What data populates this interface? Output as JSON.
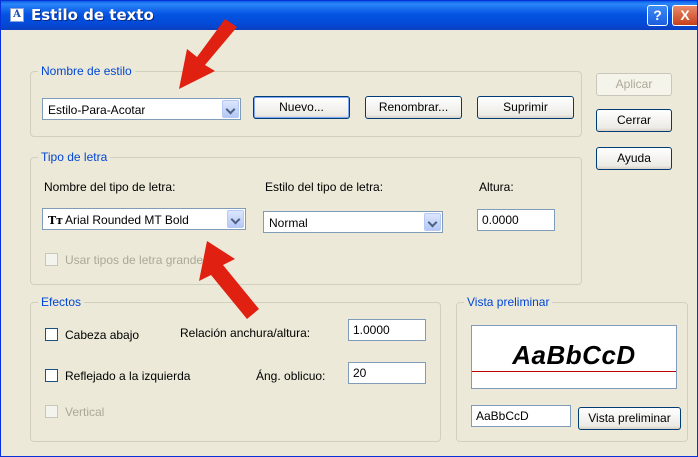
{
  "window": {
    "title": "Estilo de texto",
    "help_button": "?",
    "close_button": "X"
  },
  "style_name": {
    "legend": "Nombre de estilo",
    "selected": "Estilo-Para-Acotar",
    "new_label": "Nuevo...",
    "rename_label": "Renombrar...",
    "delete_label": "Suprimir"
  },
  "side_buttons": {
    "apply_label": "Aplicar",
    "close_label": "Cerrar",
    "help_label": "Ayuda"
  },
  "font": {
    "legend": "Tipo de letra",
    "font_name_label": "Nombre del tipo de letra:",
    "font_name_value": "Arial Rounded MT Bold",
    "font_style_label": "Estilo del tipo de letra:",
    "font_style_value": "Normal",
    "height_label": "Altura:",
    "height_value": "0.0000",
    "big_font_label": "Usar tipos de letra grandes"
  },
  "effects": {
    "legend": "Efectos",
    "upside_down_label": "Cabeza abajo",
    "backwards_label": "Reflejado a la izquierda",
    "vertical_label": "Vertical",
    "width_factor_label": "Relación anchura/altura:",
    "width_factor_value": "1.0000",
    "oblique_label": "Áng. oblicuo:",
    "oblique_value": "20"
  },
  "preview": {
    "legend": "Vista preliminar",
    "sample_text": "AaBbCcD",
    "input_value": "AaBbCcD",
    "button_label": "Vista preliminar"
  },
  "colors": {
    "annotation_arrow": "#e02010",
    "title_bar": "#0554e3",
    "group_legend": "#0046d5",
    "baseline": "#c00000"
  }
}
